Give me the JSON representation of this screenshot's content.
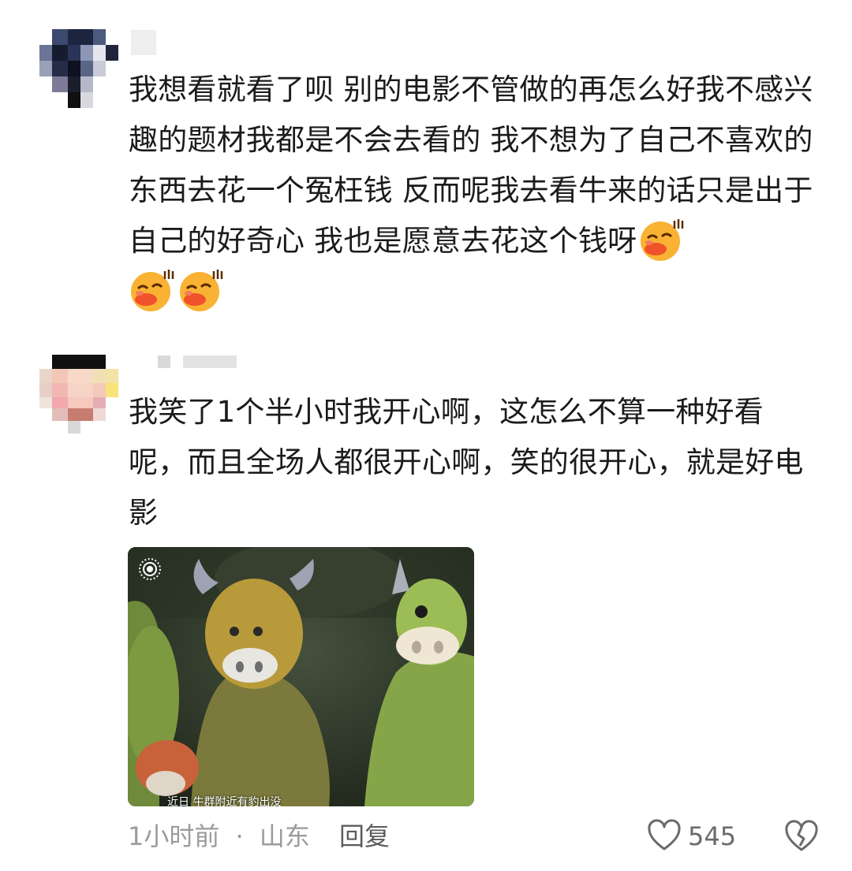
{
  "comments": [
    {
      "username": "",
      "text": "我想看就看了呗 别的电影不管做的再怎么好我不感兴趣的题材我都是不会去看的 我不想为了自己不喜欢的东西去花一个冤枉钱 反而呢我去看牛来的话只是出于自己的好奇心 我也是愿意去花这个钱呀",
      "emoji_icons": [
        "shy-kiss-emoji-icon",
        "shy-kiss-emoji-icon",
        "shy-kiss-emoji-icon"
      ]
    },
    {
      "username": "",
      "text": "我笑了1个半小时我开心啊，这怎么不算一种好看呢，而且全场人都很开心啊，笑的很开心，就是好电影",
      "image": {
        "caption": "近日 牛群附近有豹出没",
        "icon": "live-photo-icon"
      },
      "footer": {
        "time": "1小时前",
        "separator": "·",
        "location": "山东",
        "reply_label": "回复",
        "like_icon": "heart-outline-icon",
        "like_count": "545",
        "dislike_icon": "broken-heart-icon"
      }
    }
  ],
  "colors": {
    "text": "#1b1b1b",
    "meta": "#9b9b9b",
    "emoji_face": "#f9b233",
    "emoji_lips": "#f0522b"
  }
}
